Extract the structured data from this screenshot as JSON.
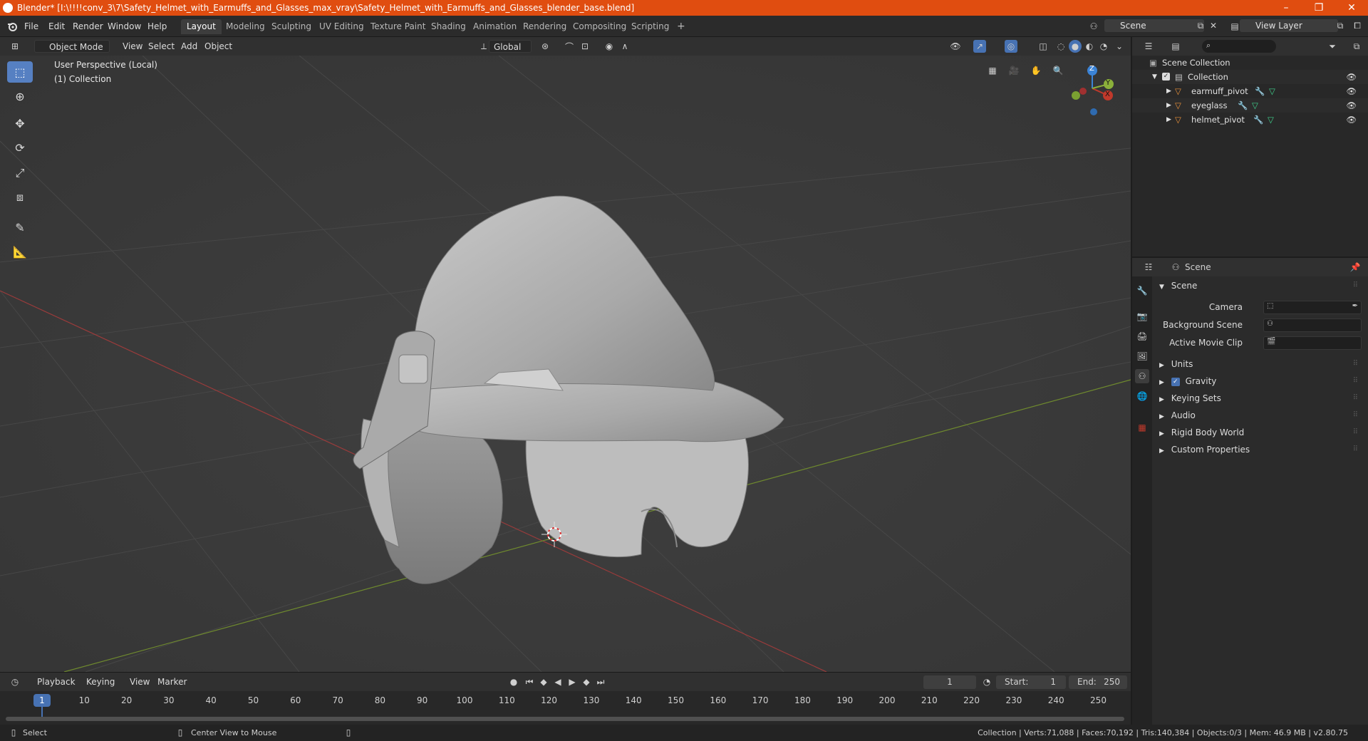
{
  "window": {
    "title": "Blender* [I:\\!!!!conv_3\\7\\Safety_Helmet_with_Earmuffs_and_Glasses_max_vray\\Safety_Helmet_with_Earmuffs_and_Glasses_blender_base.blend]",
    "minimize": "–",
    "maximize": "❐",
    "close": "✕"
  },
  "menus": [
    "File",
    "Edit",
    "Render",
    "Window",
    "Help"
  ],
  "workspaces": [
    "Layout",
    "Modeling",
    "Sculpting",
    "UV Editing",
    "Texture Paint",
    "Shading",
    "Animation",
    "Rendering",
    "Compositing",
    "Scripting"
  ],
  "workspace_active": "Layout",
  "add_workspace": "+",
  "scene_field": "Scene",
  "view_layer_field": "View Layer",
  "viewport_header": {
    "mode": "Object Mode",
    "menus": [
      "View",
      "Select",
      "Add",
      "Object"
    ],
    "transform_orientation": "Global"
  },
  "viewport": {
    "perspective_label": "User Perspective (Local)",
    "collection_label": "(1) Collection",
    "gizmo": {
      "z": "Z",
      "y": "Y",
      "x": "X"
    }
  },
  "outliner": {
    "root": "Scene Collection",
    "collection": "Collection",
    "objects": [
      "earmuff_pivot",
      "eyeglass",
      "helmet_pivot"
    ]
  },
  "properties": {
    "context": "Scene",
    "panel_title": "Scene",
    "fields": {
      "camera": "Camera",
      "background_scene": "Background Scene",
      "active_movie_clip": "Active Movie Clip"
    },
    "sections": [
      "Units",
      "Gravity",
      "Keying Sets",
      "Audio",
      "Rigid Body World",
      "Custom Properties"
    ]
  },
  "timeline": {
    "menus": [
      "Playback",
      "Keying",
      "View",
      "Marker"
    ],
    "current_frame": "1",
    "start_label": "Start:",
    "start": "1",
    "end_label": "End:",
    "end": "250",
    "ticks": [
      "10",
      "20",
      "30",
      "40",
      "50",
      "60",
      "70",
      "80",
      "90",
      "100",
      "110",
      "120",
      "130",
      "140",
      "150",
      "160",
      "170",
      "180",
      "190",
      "200",
      "210",
      "220",
      "230",
      "240",
      "250"
    ],
    "playhead": "1"
  },
  "statusbar": {
    "left_action": "Select",
    "mid_action": "Center View to Mouse",
    "stats": "Collection | Verts:71,088 | Faces:70,192 | Tris:140,384 | Objects:0/3 | Mem: 46.9 MB | v2.80.75"
  },
  "colors": {
    "titlebar": "#e04d10",
    "accent": "#5680c2",
    "x_axis": "#c0392b",
    "y_axis": "#8bb03a",
    "z_axis": "#3b83d6"
  }
}
